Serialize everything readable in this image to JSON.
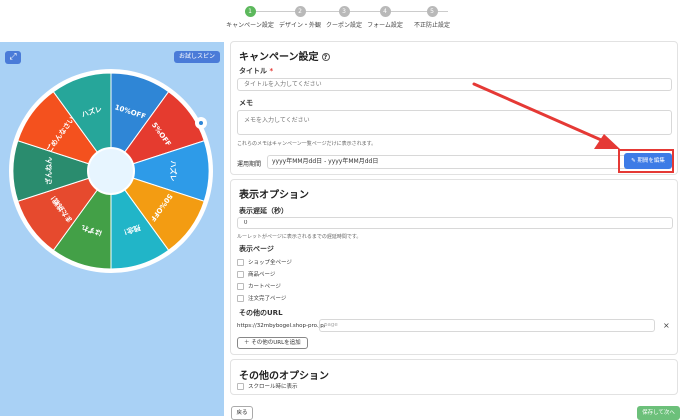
{
  "stepper": {
    "steps": [
      {
        "num": "1",
        "label": "キャンペーン設定"
      },
      {
        "num": "2",
        "label": "デザイン・外観"
      },
      {
        "num": "3",
        "label": "クーポン設定"
      },
      {
        "num": "4",
        "label": "フォーム設定"
      },
      {
        "num": "5",
        "label": "不正防止設定"
      }
    ],
    "active_step": 1,
    "active_color": "#5cb85c"
  },
  "preview": {
    "expand_icon": "expand-icon",
    "trial_spin_label": "お試しスピン",
    "background_color": "#a9d1f5",
    "wheel_segments": [
      {
        "label": "10%OFF",
        "color": "#2f86d6"
      },
      {
        "label": "5%OFF",
        "color": "#e53b2f"
      },
      {
        "label": "ハズレ",
        "color": "#2e9be8"
      },
      {
        "label": "50%OFF",
        "color": "#f39c12"
      },
      {
        "label": "残念！",
        "color": "#21b5c8"
      },
      {
        "label": "はずれ",
        "color": "#43a047"
      },
      {
        "label": "また挑戦！",
        "color": "#e64a2e"
      },
      {
        "label": "ざんねん",
        "color": "#2a8c6e"
      },
      {
        "label": "ごめんなさい",
        "color": "#f4511e"
      },
      {
        "label": "ハズレ",
        "color": "#26a69a"
      }
    ]
  },
  "campaign": {
    "title": "キャンペーン設定",
    "help_icon": "question-circle-icon",
    "title_label": "タイトル",
    "required_mark": "*",
    "title_placeholder": "タイトルを入力してください",
    "memo_label": "メモ",
    "memo_placeholder": "メモを入力してください",
    "memo_hint": "これらのメモはキャンペーン一覧ページだけに表示されます。",
    "period_label": "運用期間",
    "period_value": "yyyy年MM月dd日 - yyyy年MM月dd日",
    "edit_period_label": "期間を編集",
    "edit_icon": "edit-icon"
  },
  "display_options": {
    "title": "表示オプション",
    "delay_label": "表示遅延（秒）",
    "delay_value": "0",
    "delay_hint": "ルーレットがページに表示されるまでの遅延時間です。",
    "pages_label": "表示ページ",
    "pages": [
      "ショップ全ページ",
      "商品ページ",
      "カートページ",
      "注文完了ページ"
    ],
    "other_url_label": "その他のURL",
    "url_prefix": "https://32mbybogel.shop-pro.jp/",
    "url_placeholder": "page",
    "clear_icon": "close-icon",
    "add_url_label": "その他のURLを追加"
  },
  "other_options": {
    "title": "その他のオプション",
    "scroll_label": "スクロール時に表示"
  },
  "footer": {
    "back_label": "戻る",
    "next_label": "保存して次へ"
  },
  "annotation": {
    "arrow_color": "#e53935",
    "highlight_color": "#e53935"
  }
}
